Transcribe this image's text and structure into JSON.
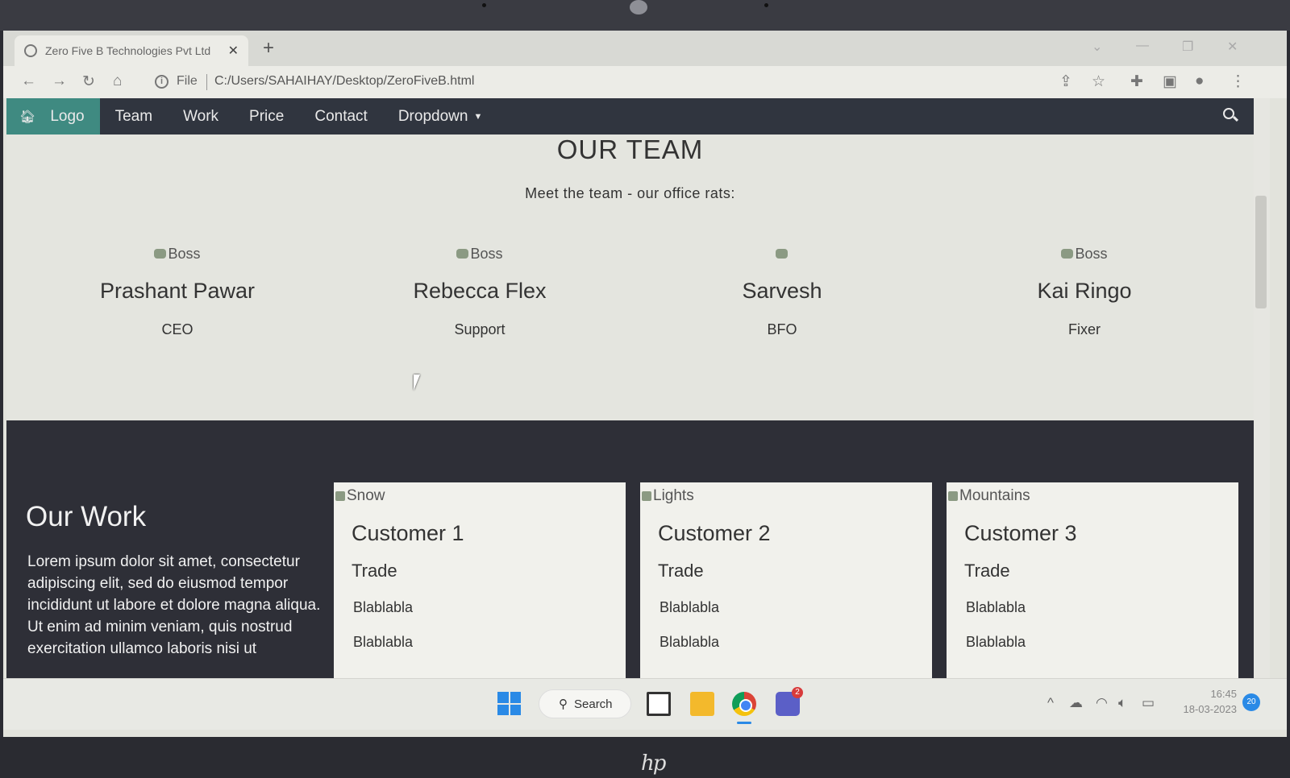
{
  "browser": {
    "tab_title": "Zero Five B Technologies Pvt Ltd",
    "tab_close": "✕",
    "new_tab": "+",
    "url_scheme": "File",
    "url": "C:/Users/SAHAIHAY/Desktop/ZeroFiveB.html"
  },
  "nav": {
    "home_label": "Logo",
    "items": [
      "Team",
      "Work",
      "Price",
      "Contact"
    ],
    "dropdown_label": "Dropdown"
  },
  "team": {
    "title": "OUR TEAM",
    "subtitle": "Meet the team - our office rats:",
    "members": [
      {
        "img_alt": "Boss",
        "name": "Prashant Pawar",
        "role": "CEO"
      },
      {
        "img_alt": "Boss",
        "name": "Rebecca Flex",
        "role": "Support"
      },
      {
        "img_alt": "",
        "name": "Sarvesh",
        "role": "BFO"
      },
      {
        "img_alt": "Boss",
        "name": "Kai Ringo",
        "role": "Fixer"
      }
    ]
  },
  "work": {
    "title": "Our Work",
    "text": "Lorem ipsum dolor sit amet, consectetur adipiscing elit, sed do eiusmod tempor incididunt ut labore et dolore magna aliqua. Ut enim ad minim veniam, quis nostrud exercitation ullamco laboris nisi ut",
    "cards": [
      {
        "img_alt": "Snow",
        "title": "Customer 1",
        "trade": "Trade",
        "line1": "Blablabla",
        "line2": "Blablabla"
      },
      {
        "img_alt": "Lights",
        "title": "Customer 2",
        "trade": "Trade",
        "line1": "Blablabla",
        "line2": "Blablabla"
      },
      {
        "img_alt": "Mountains",
        "title": "Customer 3",
        "trade": "Trade",
        "line1": "Blablabla",
        "line2": "Blablabla"
      }
    ]
  },
  "taskbar": {
    "search_label": "Search",
    "teams_badge": "2",
    "time": "16:45",
    "date": "18-03-2023",
    "notifications": "20"
  },
  "colors": {
    "nav_bg": "#30353f",
    "nav_active": "#3f8a81",
    "work_bg": "#2e2f37",
    "page_bg": "#e4e5df"
  }
}
